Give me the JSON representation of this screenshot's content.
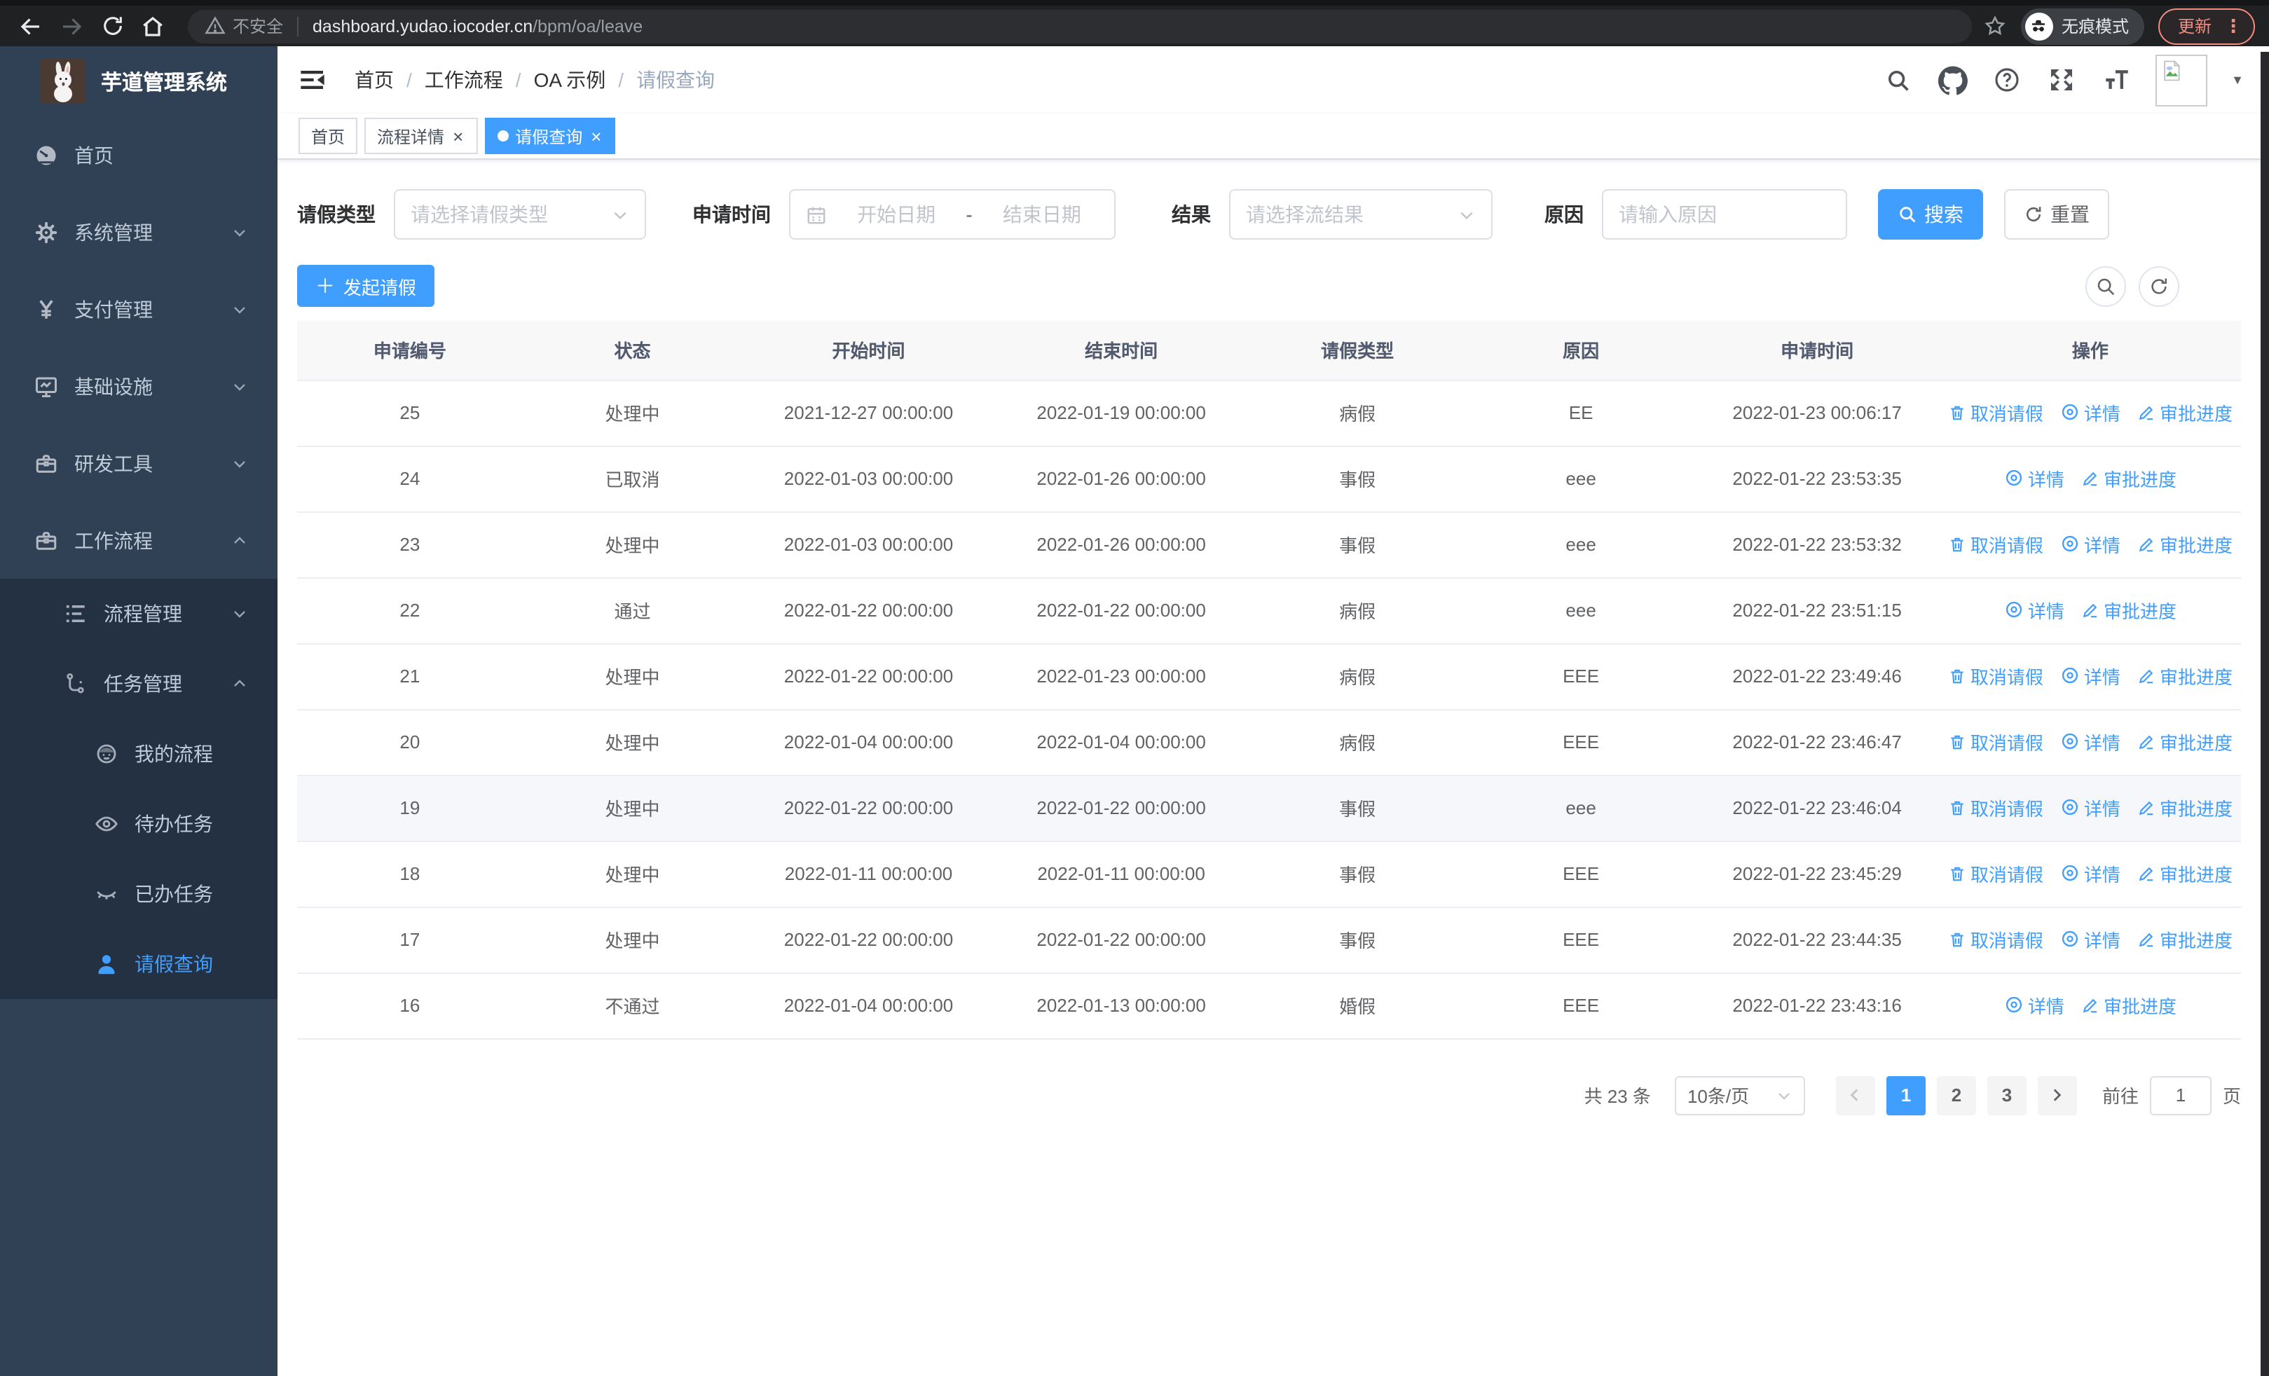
{
  "browser": {
    "security_label": "不安全",
    "url_host": "dashboard.yudao.iocoder.cn",
    "url_path": "/bpm/oa/leave",
    "incognito_label": "无痕模式",
    "update_label": "更新"
  },
  "glyphs": {
    "close": "×",
    "dots": "⋮",
    "caret": "▼",
    "plus": "＋",
    "slash": "/"
  },
  "sidebar": {
    "app_title": "芋道管理系统",
    "items": [
      {
        "label": "首页"
      },
      {
        "label": "系统管理"
      },
      {
        "label": "支付管理"
      },
      {
        "label": "基础设施"
      },
      {
        "label": "研发工具"
      },
      {
        "label": "工作流程"
      }
    ],
    "submenu": [
      {
        "label": "流程管理"
      },
      {
        "label": "任务管理"
      }
    ],
    "task_items": [
      {
        "label": "我的流程"
      },
      {
        "label": "待办任务"
      },
      {
        "label": "已办任务"
      },
      {
        "label": "请假查询",
        "active": true
      }
    ]
  },
  "header": {
    "breadcrumb": [
      "首页",
      "工作流程",
      "OA 示例",
      "请假查询"
    ]
  },
  "tabs": [
    {
      "label": "首页",
      "closable": false,
      "active": false
    },
    {
      "label": "流程详情",
      "closable": true,
      "active": false
    },
    {
      "label": "请假查询",
      "closable": true,
      "active": true
    }
  ],
  "filters": {
    "leave_type_label": "请假类型",
    "leave_type_placeholder": "请选择请假类型",
    "apply_time_label": "申请时间",
    "start_date_placeholder": "开始日期",
    "range_separator": "-",
    "end_date_placeholder": "结束日期",
    "result_label": "结果",
    "result_placeholder": "请选择流结果",
    "reason_label": "原因",
    "reason_placeholder": "请输入原因",
    "search_label": "搜索",
    "reset_label": "重置"
  },
  "toolbar": {
    "create_label": "发起请假"
  },
  "table": {
    "columns": [
      "申请编号",
      "状态",
      "开始时间",
      "结束时间",
      "请假类型",
      "原因",
      "申请时间",
      "操作"
    ],
    "action_labels": {
      "cancel": "取消请假",
      "detail": "详情",
      "progress": "审批进度"
    },
    "rows": [
      {
        "id": "25",
        "status": "处理中",
        "start": "2021-12-27 00:00:00",
        "end": "2022-01-19 00:00:00",
        "type": "病假",
        "reason": "EE",
        "apply_time": "2022-01-23 00:06:17",
        "actions": [
          "cancel",
          "detail",
          "progress"
        ]
      },
      {
        "id": "24",
        "status": "已取消",
        "start": "2022-01-03 00:00:00",
        "end": "2022-01-26 00:00:00",
        "type": "事假",
        "reason": "eee",
        "apply_time": "2022-01-22 23:53:35",
        "actions": [
          "detail",
          "progress"
        ]
      },
      {
        "id": "23",
        "status": "处理中",
        "start": "2022-01-03 00:00:00",
        "end": "2022-01-26 00:00:00",
        "type": "事假",
        "reason": "eee",
        "apply_time": "2022-01-22 23:53:32",
        "actions": [
          "cancel",
          "detail",
          "progress"
        ]
      },
      {
        "id": "22",
        "status": "通过",
        "start": "2022-01-22 00:00:00",
        "end": "2022-01-22 00:00:00",
        "type": "病假",
        "reason": "eee",
        "apply_time": "2022-01-22 23:51:15",
        "actions": [
          "detail",
          "progress"
        ]
      },
      {
        "id": "21",
        "status": "处理中",
        "start": "2022-01-22 00:00:00",
        "end": "2022-01-23 00:00:00",
        "type": "病假",
        "reason": "EEE",
        "apply_time": "2022-01-22 23:49:46",
        "actions": [
          "cancel",
          "detail",
          "progress"
        ]
      },
      {
        "id": "20",
        "status": "处理中",
        "start": "2022-01-04 00:00:00",
        "end": "2022-01-04 00:00:00",
        "type": "病假",
        "reason": "EEE",
        "apply_time": "2022-01-22 23:46:47",
        "actions": [
          "cancel",
          "detail",
          "progress"
        ]
      },
      {
        "id": "19",
        "status": "处理中",
        "start": "2022-01-22 00:00:00",
        "end": "2022-01-22 00:00:00",
        "type": "事假",
        "reason": "eee",
        "apply_time": "2022-01-22 23:46:04",
        "actions": [
          "cancel",
          "detail",
          "progress"
        ],
        "hovered": true
      },
      {
        "id": "18",
        "status": "处理中",
        "start": "2022-01-11 00:00:00",
        "end": "2022-01-11 00:00:00",
        "type": "事假",
        "reason": "EEE",
        "apply_time": "2022-01-22 23:45:29",
        "actions": [
          "cancel",
          "detail",
          "progress"
        ]
      },
      {
        "id": "17",
        "status": "处理中",
        "start": "2022-01-22 00:00:00",
        "end": "2022-01-22 00:00:00",
        "type": "事假",
        "reason": "EEE",
        "apply_time": "2022-01-22 23:44:35",
        "actions": [
          "cancel",
          "detail",
          "progress"
        ]
      },
      {
        "id": "16",
        "status": "不通过",
        "start": "2022-01-04 00:00:00",
        "end": "2022-01-13 00:00:00",
        "type": "婚假",
        "reason": "EEE",
        "apply_time": "2022-01-22 23:43:16",
        "actions": [
          "detail",
          "progress"
        ]
      }
    ]
  },
  "pagination": {
    "total_label": "共 23 条",
    "page_size_label": "10条/页",
    "pages": [
      "1",
      "2",
      "3"
    ],
    "active_page": "1",
    "goto_label": "前往",
    "goto_value": "1",
    "goto_suffix": "页"
  },
  "colors": {
    "primary": "#409eff",
    "sidebar_bg": "#304156",
    "submenu_bg": "#243142"
  }
}
